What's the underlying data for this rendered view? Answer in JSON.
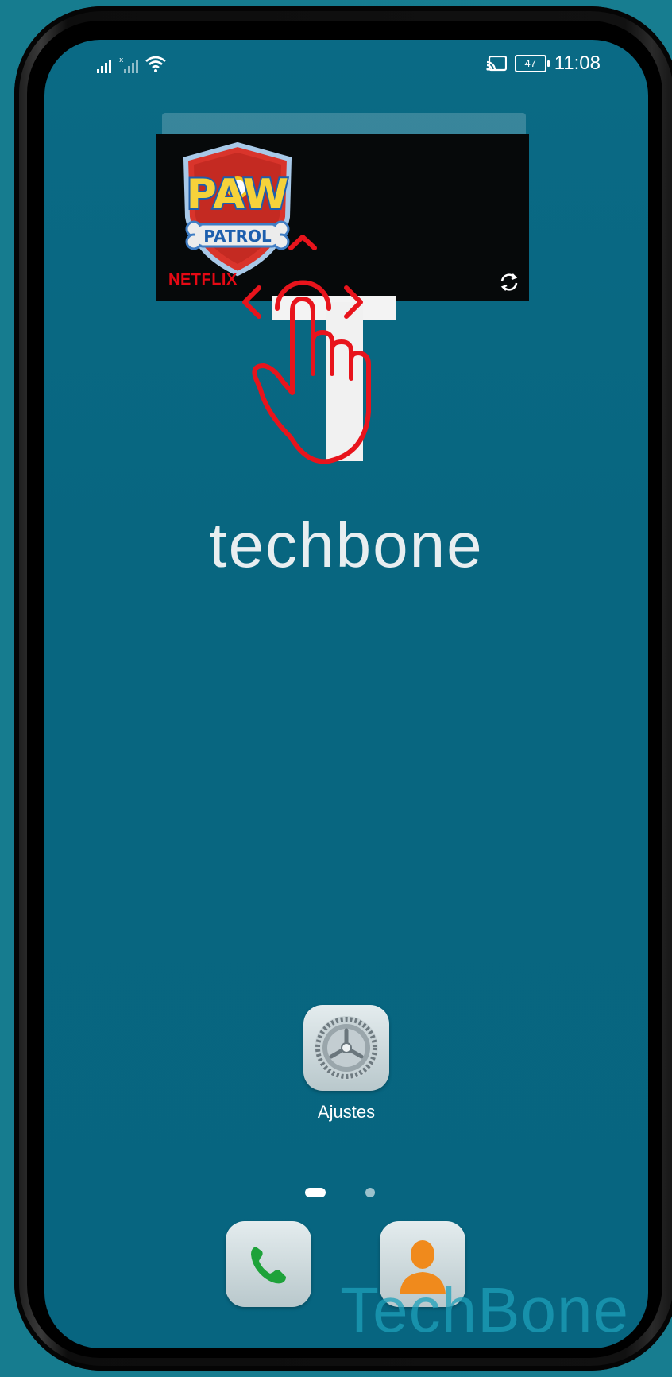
{
  "status_bar": {
    "time": "11:08",
    "battery_level": "47",
    "icons": [
      "signal-icon",
      "signal-no-sim-icon",
      "wifi-icon",
      "cast-icon",
      "battery-icon"
    ]
  },
  "widget": {
    "logo_text_top": "PAW",
    "logo_text_bottom": "PATROL",
    "provider": "NETFLIX",
    "refresh_icon": "refresh-icon"
  },
  "gesture_hint": {
    "icon": "drag-hand-icon",
    "color": "#e8141c"
  },
  "wallpaper": {
    "brand": "techbone"
  },
  "home_apps": [
    {
      "label": "Ajustes",
      "icon": "settings-gear-icon"
    }
  ],
  "page_indicator": {
    "pages": 2,
    "current": 1
  },
  "dock": [
    {
      "icon": "phone-icon"
    },
    {
      "icon": "contacts-icon"
    }
  ],
  "watermark": "TechBone",
  "colors": {
    "background": "#177a8e",
    "screen": "#086680",
    "netflix_red": "#e50914"
  }
}
